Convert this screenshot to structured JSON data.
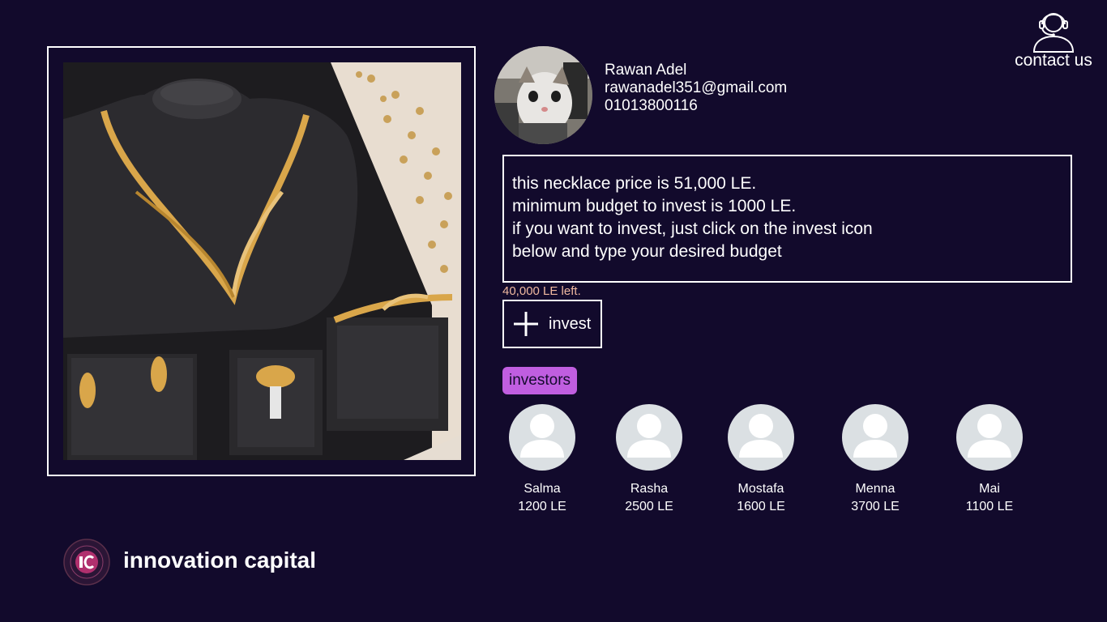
{
  "seller": {
    "name": "Rawan Adel",
    "email": "rawanadel351@gmail.com",
    "phone": "01013800116"
  },
  "contact": {
    "label": "contact us"
  },
  "description": {
    "lines": [
      "this necklace price is 51,000 LE.",
      "minimum budget to invest  is 1000 LE.",
      "if you want to invest, just click on the invest icon",
      "below and type your desired budget"
    ]
  },
  "remaining": "40,000 LE left.",
  "invest_button": {
    "label": "invest"
  },
  "investors": {
    "title": "investors",
    "list": [
      {
        "name": "Salma",
        "amount": "1200 LE"
      },
      {
        "name": "Rasha",
        "amount": "2500 LE"
      },
      {
        "name": "Mostafa",
        "amount": "1600 LE"
      },
      {
        "name": "Menna",
        "amount": "3700 LE"
      },
      {
        "name": "Mai",
        "amount": "1100 LE"
      }
    ]
  },
  "brand": {
    "name": "innovation capital"
  },
  "colors": {
    "background": "#120a2c",
    "badge": "#c05ee0",
    "remaining_text": "#f0b9a0",
    "gold": "#d9a64a"
  }
}
